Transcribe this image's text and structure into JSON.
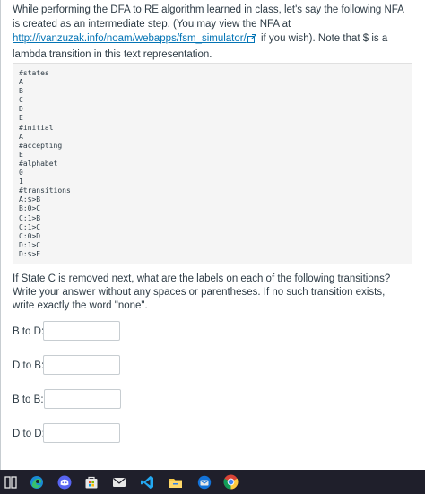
{
  "intro": {
    "before_link": "While performing the DFA to RE algorithm learned in class, let's say the following NFA is created as an intermediate step. (You may view the NFA at ",
    "link_text": "http://ivanzuzak.info/noam/webapps/fsm_simulator/",
    "after_link": " if you wish). Note that $ is a lambda transition in this text representation."
  },
  "nfa_text": "#states\nA\nB\nC\nD\nE\n#initial\nA\n#accepting\nE\n#alphabet\n0\n1\n#transitions\nA:$>B\nB:0>C\nC:1>B\nC:1>C\nC:0>D\nD:1>C\nD:$>E",
  "question": "If State C is removed next, what are the labels on each of the following transitions? Write your answer without any spaces or parentheses. If no such transition exists, write exactly the word \"none\".",
  "answers": [
    {
      "label": "B to D:",
      "value": ""
    },
    {
      "label": "D to B:",
      "value": ""
    },
    {
      "label": "B to B:",
      "value": ""
    },
    {
      "label": "D to D:",
      "value": ""
    }
  ],
  "taskbar": {
    "icons": [
      "task-view-icon",
      "edge-icon",
      "discord-icon",
      "microsoft-store-icon",
      "mail-icon",
      "vscode-icon",
      "file-explorer-icon",
      "thunderbird-icon",
      "chrome-icon"
    ]
  },
  "colors": {
    "link": "#0374b5",
    "text": "#2d3b45",
    "code_background": "#f5f5f5",
    "taskbar": "#1f1f2b"
  }
}
